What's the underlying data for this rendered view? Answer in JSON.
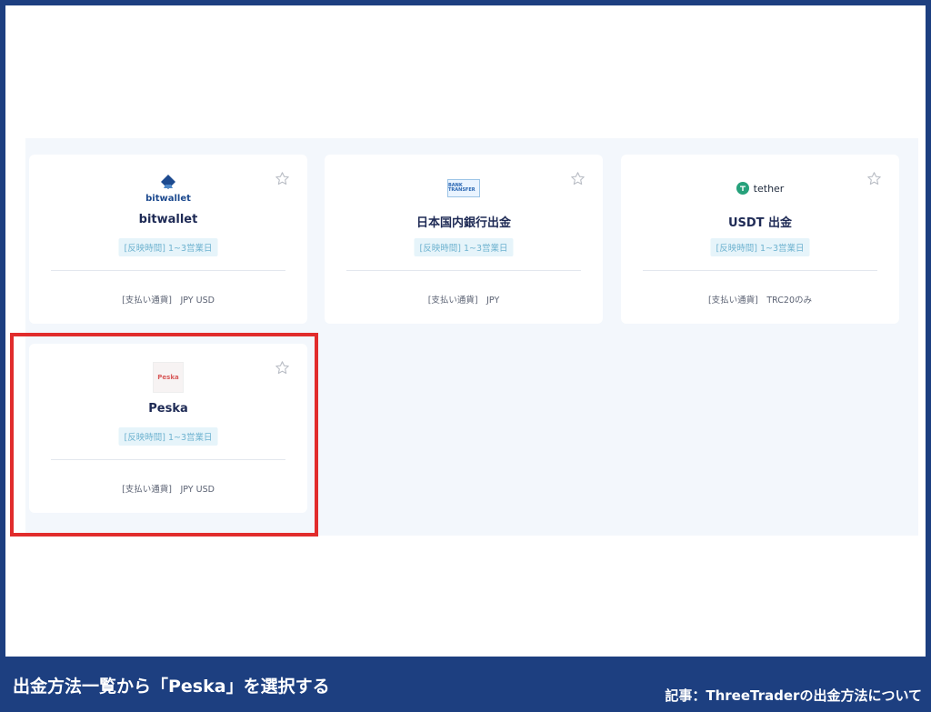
{
  "methods": [
    {
      "name": "bitwallet",
      "logo_text": "bitwallet",
      "logo_icon": "bitwallet-logo-icon",
      "badge": "[反映時間] 1~3営業日",
      "currency": "[支払い通貨]　JPY USD"
    },
    {
      "name": "日本国内銀行出金",
      "logo_text": "BANK TRANSFER",
      "logo_icon": "bank-transfer-logo-icon",
      "badge": "[反映時間] 1~3営業日",
      "currency": "[支払い通貨]　JPY"
    },
    {
      "name": "USDT 出金",
      "logo_text": "tether",
      "logo_icon": "tether-logo-icon",
      "badge": "[反映時間] 1~3営業日",
      "currency": "[支払い通貨]　TRC20のみ"
    },
    {
      "name": "Peska",
      "logo_text": "Peska",
      "logo_icon": "peska-logo-icon",
      "badge": "[反映時間] 1~3営業日",
      "currency": "[支払い通貨]　JPY USD"
    }
  ],
  "caption": "出金方法一覧から「Peska」を選択する",
  "article_note": "記事：ThreeTraderの出金方法について",
  "colors": {
    "frame": "#1d3f80",
    "highlight": "#e12c2c",
    "badge_bg": "#e6f4fa",
    "badge_text": "#6fb3d0",
    "tether": "#26a17b"
  }
}
